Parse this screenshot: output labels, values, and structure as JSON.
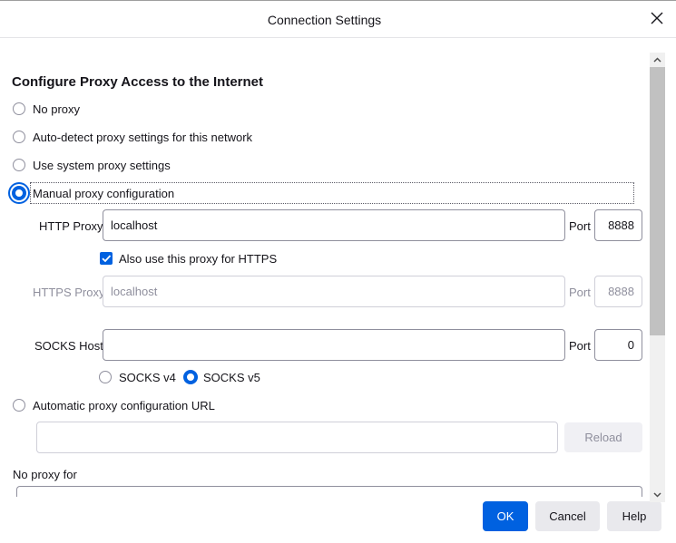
{
  "dialog": {
    "title": "Connection Settings"
  },
  "proxy": {
    "section_title": "Configure Proxy Access to the Internet",
    "options": {
      "no_proxy": "No proxy",
      "auto_detect": "Auto-detect proxy settings for this network",
      "system": "Use system proxy settings",
      "manual": "Manual proxy configuration",
      "auto_url": "Automatic proxy configuration URL"
    },
    "selected": "manual",
    "http": {
      "label": "HTTP Proxy",
      "value": "localhost",
      "port_label": "Port",
      "port": "8888"
    },
    "also_https": {
      "label": "Also use this proxy for HTTPS",
      "checked": true
    },
    "https": {
      "label": "HTTPS Proxy",
      "value": "localhost",
      "port_label": "Port",
      "port": "8888"
    },
    "socks": {
      "label": "SOCKS Host",
      "value": "",
      "port_label": "Port",
      "port": "0",
      "v4": "SOCKS v4",
      "v5": "SOCKS v5",
      "version_selected": "v5"
    },
    "auto_url": {
      "value": "",
      "reload_label": "Reload"
    },
    "no_proxy_for": {
      "label": "No proxy for",
      "value": ""
    }
  },
  "buttons": {
    "ok": "OK",
    "cancel": "Cancel",
    "help": "Help"
  },
  "colors": {
    "accent": "#0061e0",
    "border": "#8f8f9d",
    "disabled_text": "#8f8f9d",
    "button_gray": "#e9e9ed"
  }
}
